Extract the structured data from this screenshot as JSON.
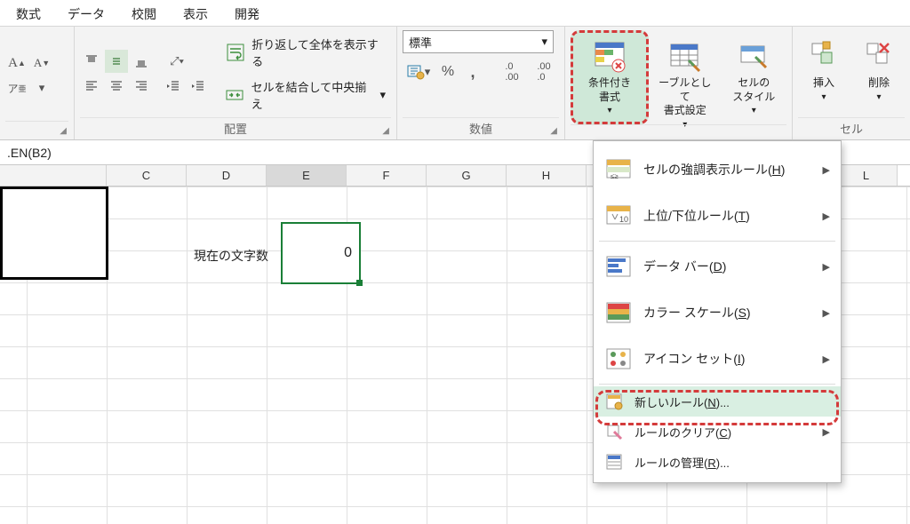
{
  "tabs": [
    "数式",
    "データ",
    "校閲",
    "表示",
    "開発"
  ],
  "ribbon": {
    "font": {
      "caption": ""
    },
    "alignment": {
      "wrap": "折り返して全体を表示する",
      "merge": "セルを結合して中央揃え",
      "caption": "配置"
    },
    "number": {
      "format_selected": "標準",
      "caption": "数値"
    },
    "styles": {
      "cond_fmt": "条件付き\n書式",
      "as_table": "ーブルとして\n書式設定",
      "cell_styles": "セルの\nスタイル"
    },
    "cells": {
      "insert": "挿入",
      "delete": "削除",
      "caption": "セル"
    }
  },
  "cf_menu": {
    "highlight_rules": "セルの強調表示ルール(H)",
    "top_bottom": "上位/下位ルール(T)",
    "data_bars": "データ バー(D)",
    "color_scales": "カラー スケール(S)",
    "icon_sets": "アイコン セット(I)",
    "new_rule": "新しいルール(N)...",
    "clear_rules": "ルールのクリア(C)",
    "manage_rules": "ルールの管理(R)..."
  },
  "formula_bar": ".EN(B2)",
  "columns": [
    "",
    "C",
    "D",
    "E",
    "F",
    "G",
    "H",
    "",
    "",
    "L"
  ],
  "cells": {
    "D_label": "現在の文字数",
    "E_value": "0"
  }
}
